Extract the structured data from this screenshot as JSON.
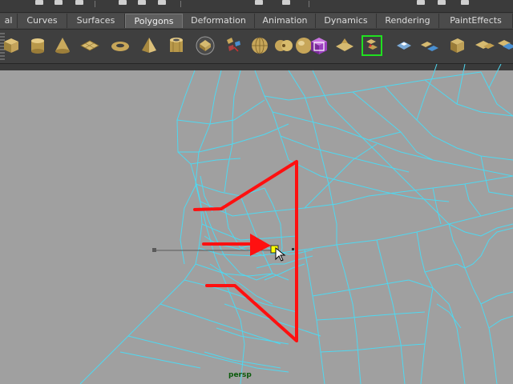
{
  "tabs": [
    {
      "label": "al",
      "active": false
    },
    {
      "label": "Curves",
      "active": false
    },
    {
      "label": "Surfaces",
      "active": false
    },
    {
      "label": "Polygons",
      "active": true
    },
    {
      "label": "Deformation",
      "active": false
    },
    {
      "label": "Animation",
      "active": false
    },
    {
      "label": "Dynamics",
      "active": false
    },
    {
      "label": "Rendering",
      "active": false
    },
    {
      "label": "PaintEffects",
      "active": false
    }
  ],
  "shelf_icons": [
    "poly-cube-icon",
    "poly-cylinder-icon",
    "poly-cone-icon",
    "poly-plane-icon",
    "poly-torus-icon",
    "poly-pyramid-icon",
    "poly-pipe-icon",
    "poly-helix-icon",
    "poly-soccerball-icon",
    "combine-icon",
    "separate-icon",
    "smooth-icon",
    "sculpt-icon",
    "bevel-icon",
    "split-polygon-icon",
    "extrude-icon",
    "extrude-face-icon",
    "merge-icon",
    "bridge-icon",
    "append-icon"
  ],
  "viewport": {
    "camera_label": "persp",
    "wire_color": "#4fd8f0",
    "annotation_color": "#ff1010",
    "selected_vertex_color": "#ffff00"
  }
}
